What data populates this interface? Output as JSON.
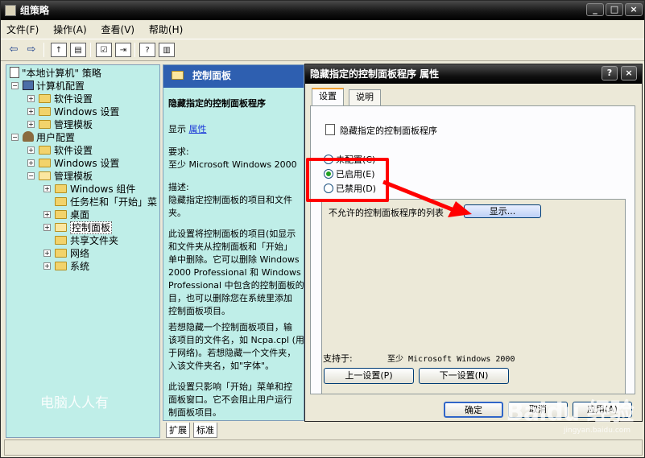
{
  "window": {
    "title": "组策略",
    "buttons": [
      "_",
      "□",
      "×"
    ]
  },
  "menu": [
    "文件(F)",
    "操作(A)",
    "查看(V)",
    "帮助(H)"
  ],
  "tree": {
    "root": "\"本地计算机\" 策略",
    "computer": "计算机配置",
    "computer_items": [
      "软件设置",
      "Windows 设置",
      "管理模板"
    ],
    "user": "用户配置",
    "user_items": [
      "软件设置",
      "Windows 设置",
      "管理模板"
    ],
    "admin_items": [
      "Windows 组件",
      "任务栏和「开始」菜",
      "桌面",
      "控制面板",
      "共享文件夹",
      "网络",
      "系统"
    ]
  },
  "desc": {
    "header": "控制面板",
    "title": "隐藏指定的控制面板程序",
    "show_label": "显示",
    "show_link": "属性",
    "req_label": "要求:",
    "req_value": "至少 Microsoft Windows 2000",
    "desc_label": "描述:",
    "desc_text": "隐藏指定控制面板的项目和文件\n夹。",
    "para1": "此设置将控制面板的项目(如显示\n和文件夹从控制面板和「开始」\n单中删除。它可以删除 Windows\n2000 Professional 和 Windows XP\nProfessional 中包含的控制面板的\n目，也可以删除您在系统里添加\n控制面板项目。",
    "para2": "若想隐藏一个控制面板项目，输\n该项目的文件名，如 Ncpa.cpl (用\n于网络)。若想隐藏一个文件夹，\n入该文件夹名，如\"字体\"。",
    "para3": "此设置只影响「开始」菜单和控\n面板窗口。它不会阻止用户运行\n制面板项目。",
    "watermark": "电脑人人有",
    "tabs": [
      "扩展",
      "标准"
    ]
  },
  "dialog": {
    "title": "隐藏指定的控制面板程序 属性",
    "buttons": [
      "?",
      "×"
    ],
    "tabs": [
      "设置",
      "说明"
    ],
    "setting_name": "隐藏指定的控制面板程序",
    "radio_not_configured": "未配置(C)",
    "radio_enabled": "已启用(E)",
    "radio_disabled": "已禁用(D)",
    "selected": "enabled",
    "list_label": "不允许的控制面板程序的列表",
    "show_button": "显示...",
    "supports_label": "支持于:",
    "supports_value": "至少 Microsoft Windows 2000",
    "prev_button": "上一设置(P)",
    "next_button": "下一设置(N)",
    "ok_button": "确定",
    "cancel_button": "取消",
    "apply_button": "应用(A)"
  },
  "overlay": {
    "baidu_text": "Baidu 经验",
    "baidu_url": "jingyan.baidu.com",
    "highlight_color": "#ff0000"
  }
}
